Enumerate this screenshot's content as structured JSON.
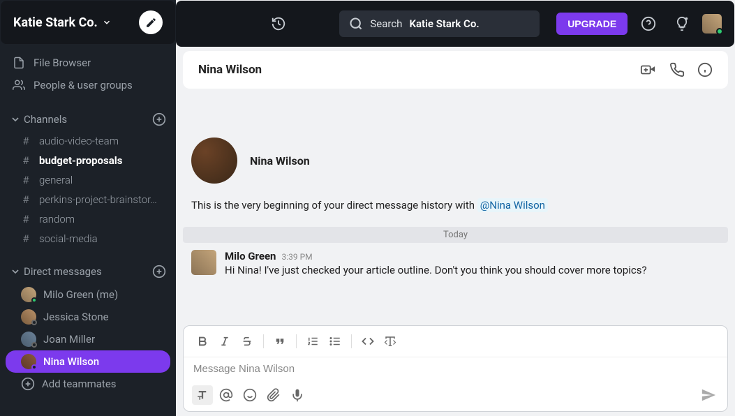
{
  "workspace": {
    "name": "Katie Stark Co."
  },
  "sidebar": {
    "file_browser": "File Browser",
    "people_groups": "People & user groups",
    "channels_label": "Channels",
    "dm_label": "Direct messages",
    "channels": [
      {
        "name": "audio-video-team"
      },
      {
        "name": "budget-proposals"
      },
      {
        "name": "general"
      },
      {
        "name": "perkins-project-brainstor…"
      },
      {
        "name": "random"
      },
      {
        "name": "social-media"
      }
    ],
    "dms": [
      {
        "name": "Milo Green (me)"
      },
      {
        "name": "Jessica Stone"
      },
      {
        "name": "Joan Miller"
      },
      {
        "name": "Nina Wilson"
      }
    ],
    "add_teammates": "Add teammates"
  },
  "topbar": {
    "search_prefix": "Search  ",
    "search_ws": "Katie Stark Co.",
    "upgrade": "UPGRADE"
  },
  "chat": {
    "title": "Nina Wilson",
    "intro_name": "Nina Wilson",
    "intro_text": "This is the very beginning of your direct message history with ",
    "intro_mention": "@Nina Wilson",
    "date_divider": "Today",
    "message": {
      "name": "Milo Green",
      "time": "3:39 PM",
      "text": "Hi Nina! I've just checked your article outline. Don't you think you should cover more topics?"
    },
    "composer_placeholder": "Message Nina Wilson"
  }
}
